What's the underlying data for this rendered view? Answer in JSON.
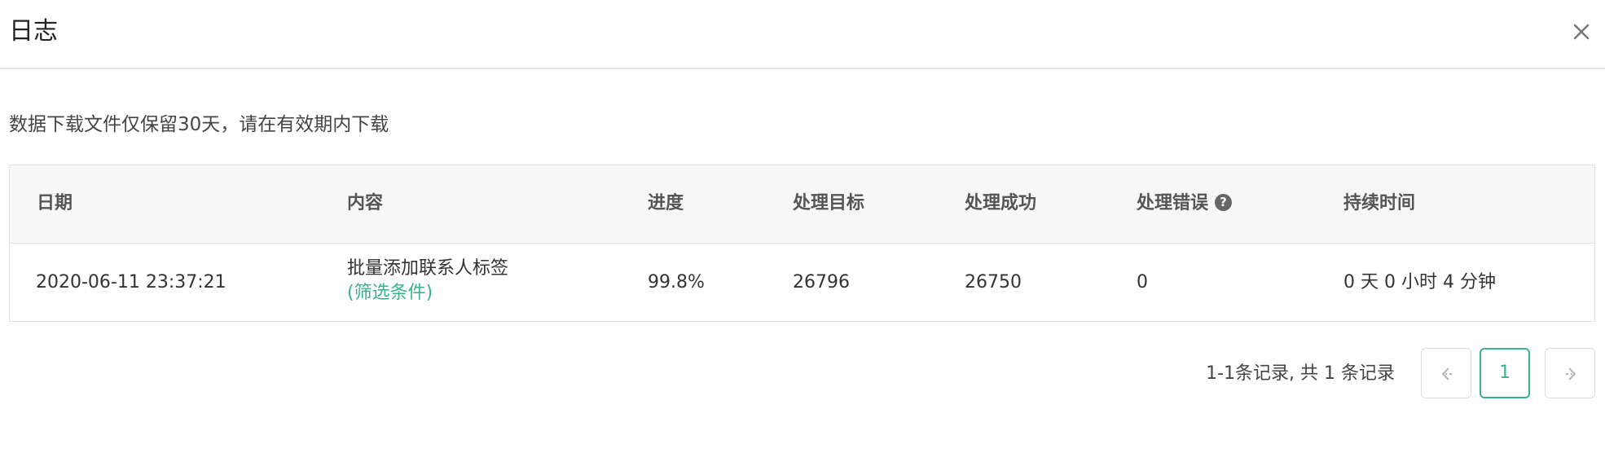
{
  "modal": {
    "title": "日志",
    "close_icon": "close-icon"
  },
  "notice": "数据下载文件仅保留30天，请在有效期内下载",
  "table": {
    "headers": {
      "date": "日期",
      "content": "内容",
      "progress": "进度",
      "target": "处理目标",
      "success": "处理成功",
      "errors": "处理错误",
      "duration": "持续时间"
    },
    "help_icon": "question-circle-icon",
    "help_glyph": "?",
    "rows": [
      {
        "date": "2020-06-11 23:37:21",
        "content": "批量添加联系人标签",
        "filter_link": "(筛选条件)",
        "progress": "99.8%",
        "target": "26796",
        "success": "26750",
        "errors": "0",
        "duration": "0 天 0 小时 4 分钟"
      }
    ]
  },
  "pagination": {
    "summary": "1-1条记录, 共 1 条记录",
    "current_page": "1",
    "prev_icon": "arrow-left-icon",
    "next_icon": "arrow-right-icon"
  },
  "colors": {
    "accent": "#3ab38a",
    "header_bg": "#f7f7f7",
    "border": "#e2e2e2"
  }
}
